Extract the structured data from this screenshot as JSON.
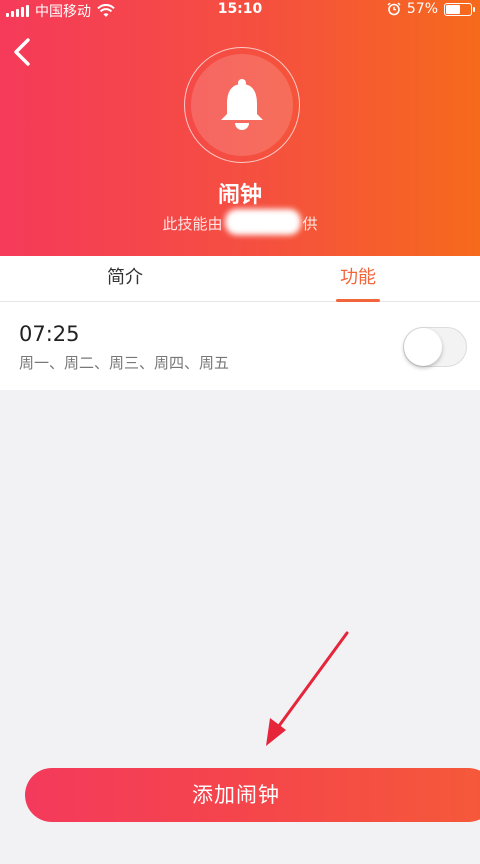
{
  "status_bar": {
    "carrier": "中国移动",
    "time": "15:10",
    "battery_percent": "57%",
    "battery_level": 0.57
  },
  "header": {
    "title": "闹钟",
    "subtitle_prefix": "此技能由",
    "subtitle_suffix": "供"
  },
  "tabs": [
    {
      "label": "简介",
      "active": false
    },
    {
      "label": "功能",
      "active": true
    }
  ],
  "alarm": {
    "time": "07:25",
    "days": "周一、周二、周三、周四、周五",
    "enabled": false
  },
  "add_button": {
    "label": "添加闹钟"
  },
  "colors": {
    "accent": "#f2643a",
    "gradient_start": "#f53a5a",
    "gradient_end": "#f66a1c",
    "annotation_arrow": "#e6253a"
  }
}
